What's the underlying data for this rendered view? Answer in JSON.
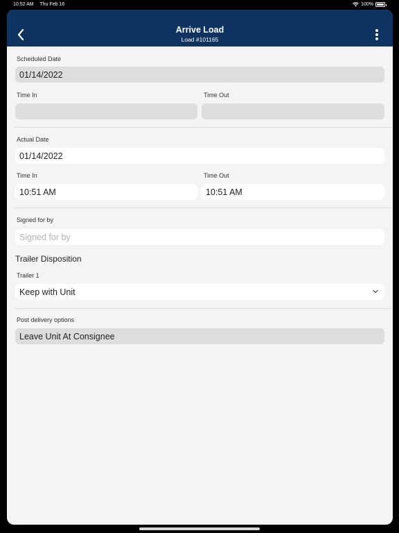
{
  "status": {
    "time": "10:52 AM",
    "date": "Thu Feb 16",
    "battery": "100%"
  },
  "nav": {
    "title": "Arrive Load",
    "subtitle": "Load #101165"
  },
  "scheduled": {
    "date_label": "Scheduled Date",
    "date_value": "01/14/2022",
    "time_in_label": "Time In",
    "time_in_value": "",
    "time_out_label": "Time Out",
    "time_out_value": ""
  },
  "actual": {
    "date_label": "Actual Date",
    "date_value": "01/14/2022",
    "time_in_label": "Time In",
    "time_in_value": "10:51 AM",
    "time_out_label": "Time Out",
    "time_out_value": "10:51 AM"
  },
  "signed": {
    "label": "Signed for by",
    "placeholder": "Signed for by"
  },
  "trailer": {
    "heading": "Trailer Disposition",
    "label": "Trailer 1",
    "value": "Keep with Unit"
  },
  "post": {
    "label": "Post delivery options",
    "value": "Leave Unit At Consignee"
  }
}
